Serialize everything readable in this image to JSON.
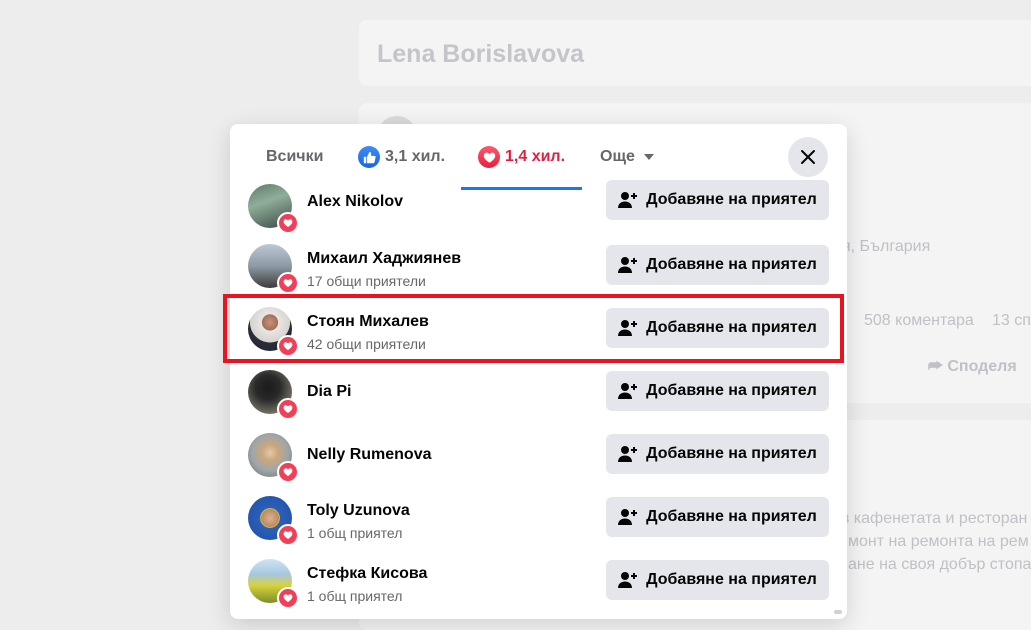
{
  "background": {
    "profile_name": "Lena Borislavova",
    "location_fragment": "я, България",
    "comments_count": "508 коментара",
    "shares_fragment": "13 сп",
    "share_label": "Споделя",
    "text_line_1": "з кафенетата и ресторан",
    "text_line_2": "монт на ремонта на рем",
    "text_line_3": "ане на своя добър стопа"
  },
  "modal": {
    "tabs": {
      "all": "Всички",
      "like": "3,1 хил.",
      "love": "1,4 хил.",
      "more": "Още"
    },
    "add_friend_label": "Добавяне на приятел",
    "people": [
      {
        "name": "Alex Nikolov",
        "mutual": ""
      },
      {
        "name": "Михаил Хаджиянев",
        "mutual": "17 общи приятели"
      },
      {
        "name": "Стоян Михалев",
        "mutual": "42 общи приятели"
      },
      {
        "name": "Dia Pi",
        "mutual": ""
      },
      {
        "name": "Nelly Rumenova",
        "mutual": ""
      },
      {
        "name": "Toly Uzunova",
        "mutual": "1 общ приятел"
      },
      {
        "name": "Стефка Кисова",
        "mutual": "1 общ приятел"
      }
    ]
  },
  "colors": {
    "accent": "#1877f2",
    "love": "#e41e3f",
    "highlight": "#e8141f",
    "button_bg": "#e4e6eb"
  }
}
